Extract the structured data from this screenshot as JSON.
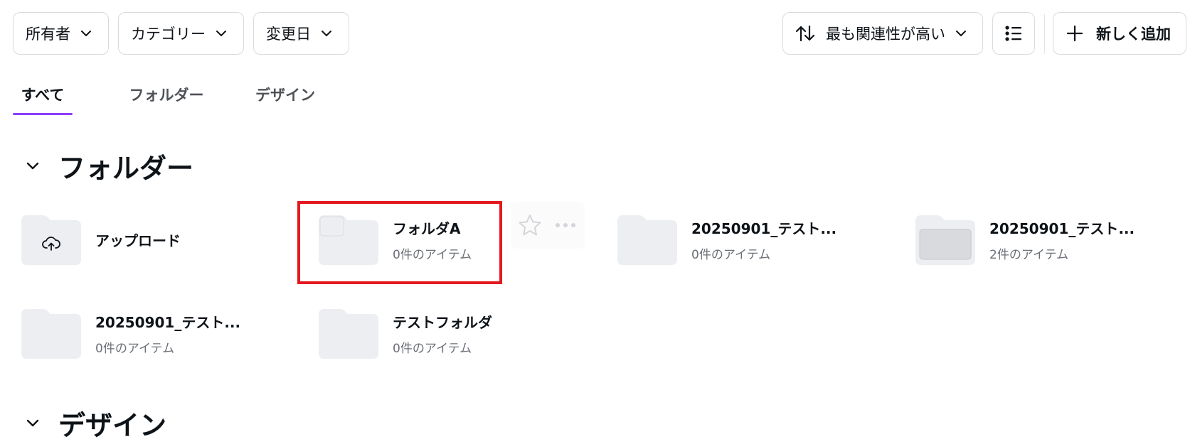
{
  "filters": {
    "owner_label": "所有者",
    "category_label": "カテゴリー",
    "modified_label": "変更日"
  },
  "sort": {
    "label": "最も関連性が高い"
  },
  "add_button": {
    "label": "新しく追加"
  },
  "tabs": [
    {
      "label": "すべて",
      "active": true
    },
    {
      "label": "フォルダー",
      "active": false
    },
    {
      "label": "デザイン",
      "active": false
    }
  ],
  "sections": {
    "folders_title": "フォルダー",
    "designs_title": "デザイン"
  },
  "folders": [
    {
      "name": "アップロード",
      "count": ""
    },
    {
      "name": "フォルダA",
      "count": "0件のアイテム"
    },
    {
      "name": "20250901_テスト...",
      "count": "0件のアイテム"
    },
    {
      "name": "20250901_テスト...",
      "count": "2件のアイテム"
    },
    {
      "name": "20250901_テスト...",
      "count": "0件のアイテム"
    },
    {
      "name": "テストフォルダ",
      "count": "0件のアイテム"
    }
  ],
  "colors": {
    "accent": "#8b3dff",
    "highlight": "#e3191f",
    "folder_fill": "#eceef1"
  }
}
